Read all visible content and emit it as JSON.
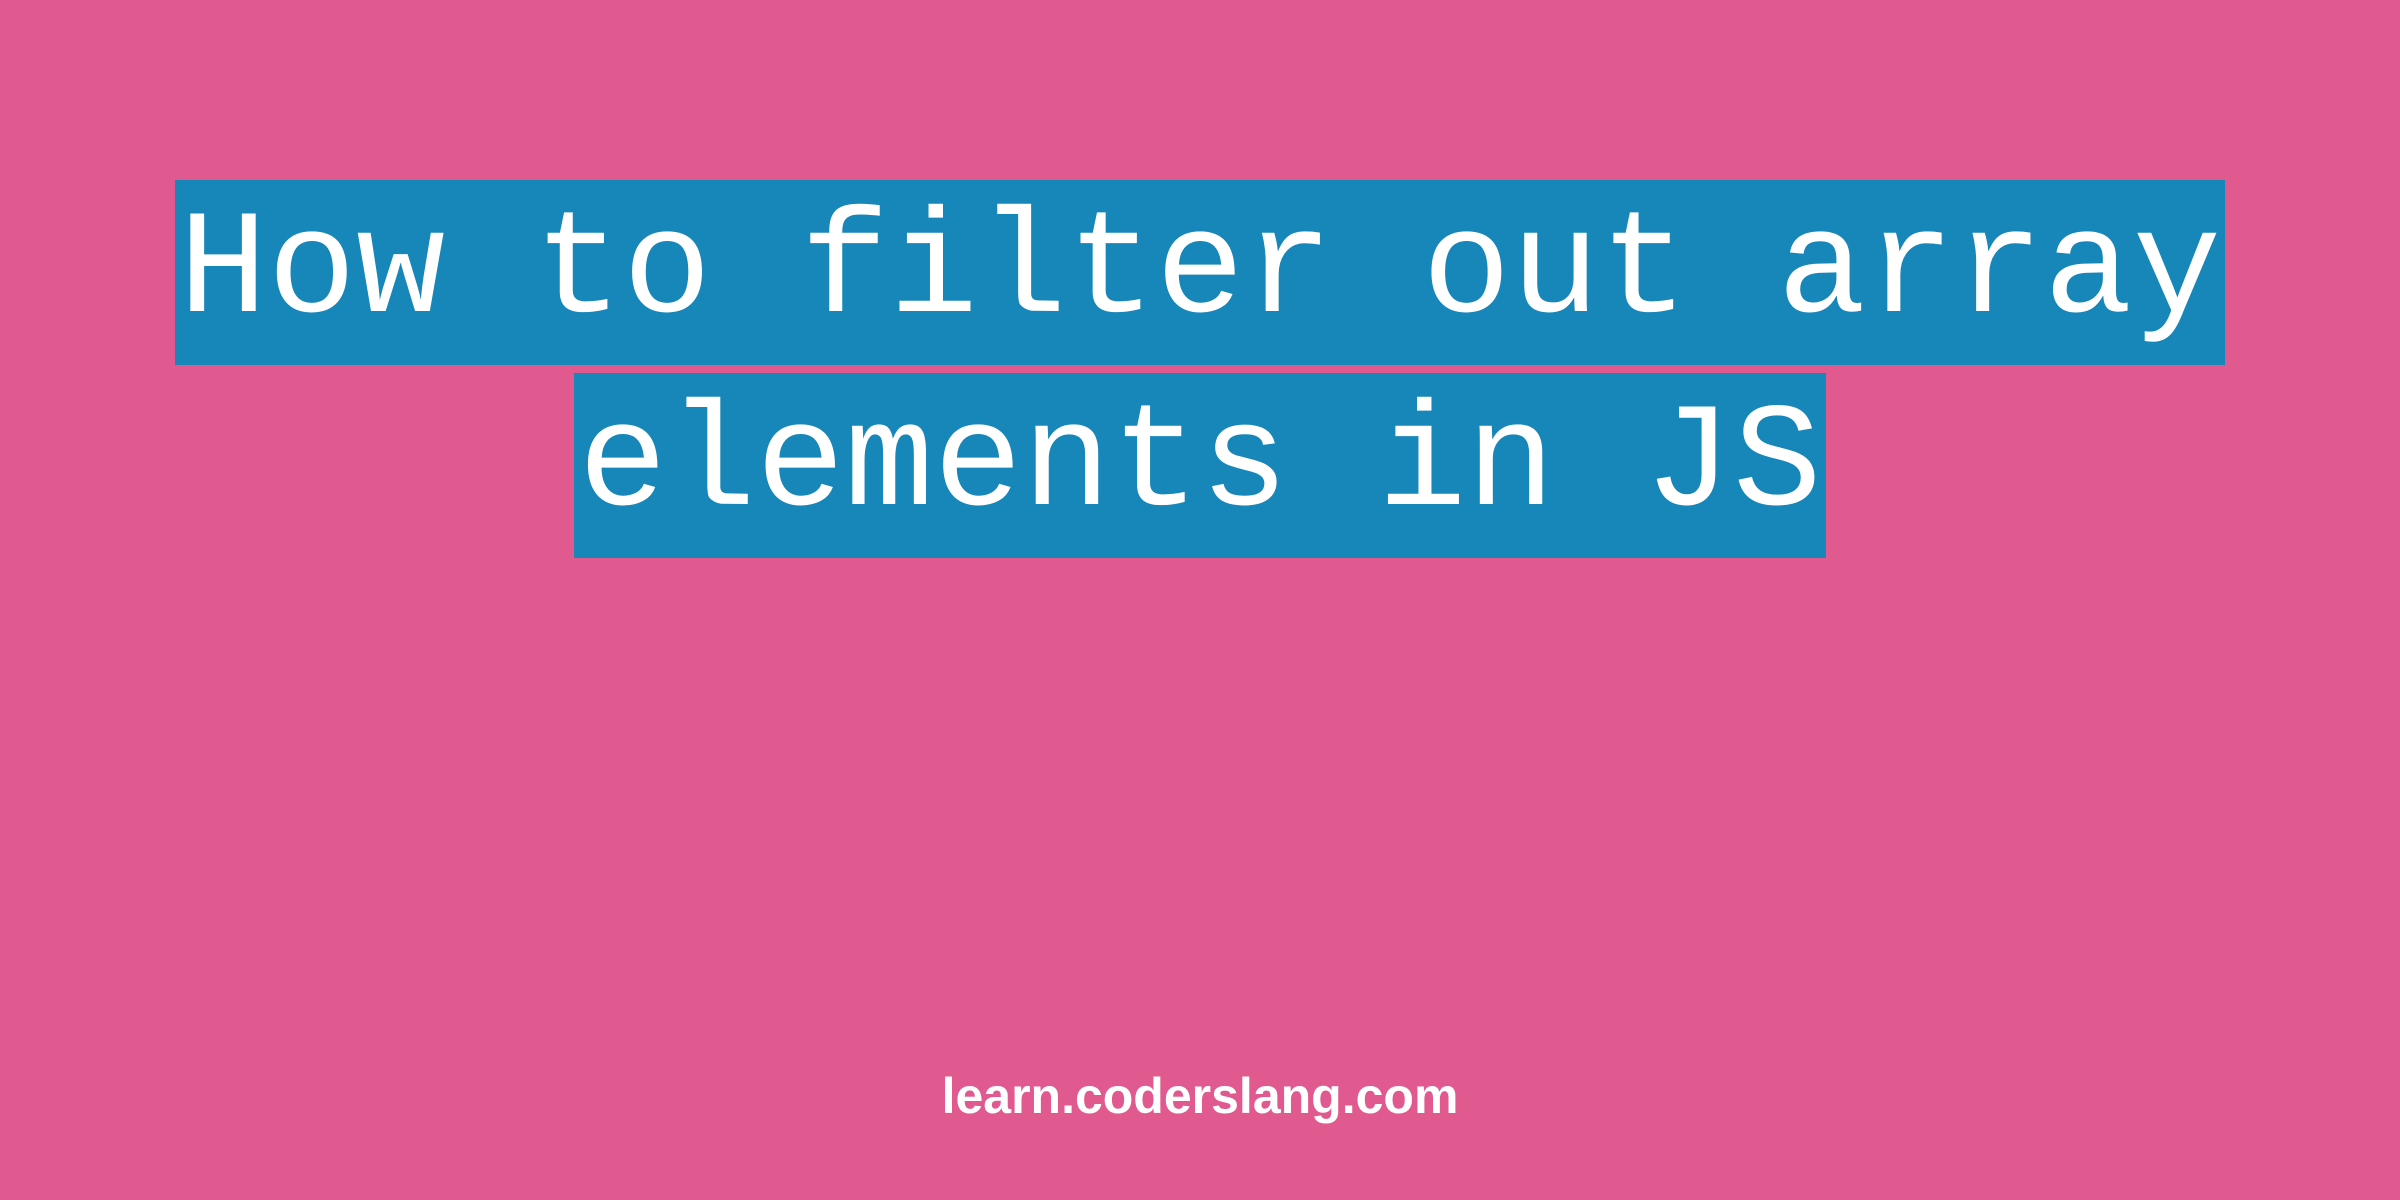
{
  "title": {
    "line1": "How to filter out array",
    "line2": "elements in JS"
  },
  "footer": {
    "url": "learn.coderslang.com"
  },
  "colors": {
    "background": "#e15a8f",
    "highlight": "#1786b8",
    "text": "#ffffff"
  }
}
